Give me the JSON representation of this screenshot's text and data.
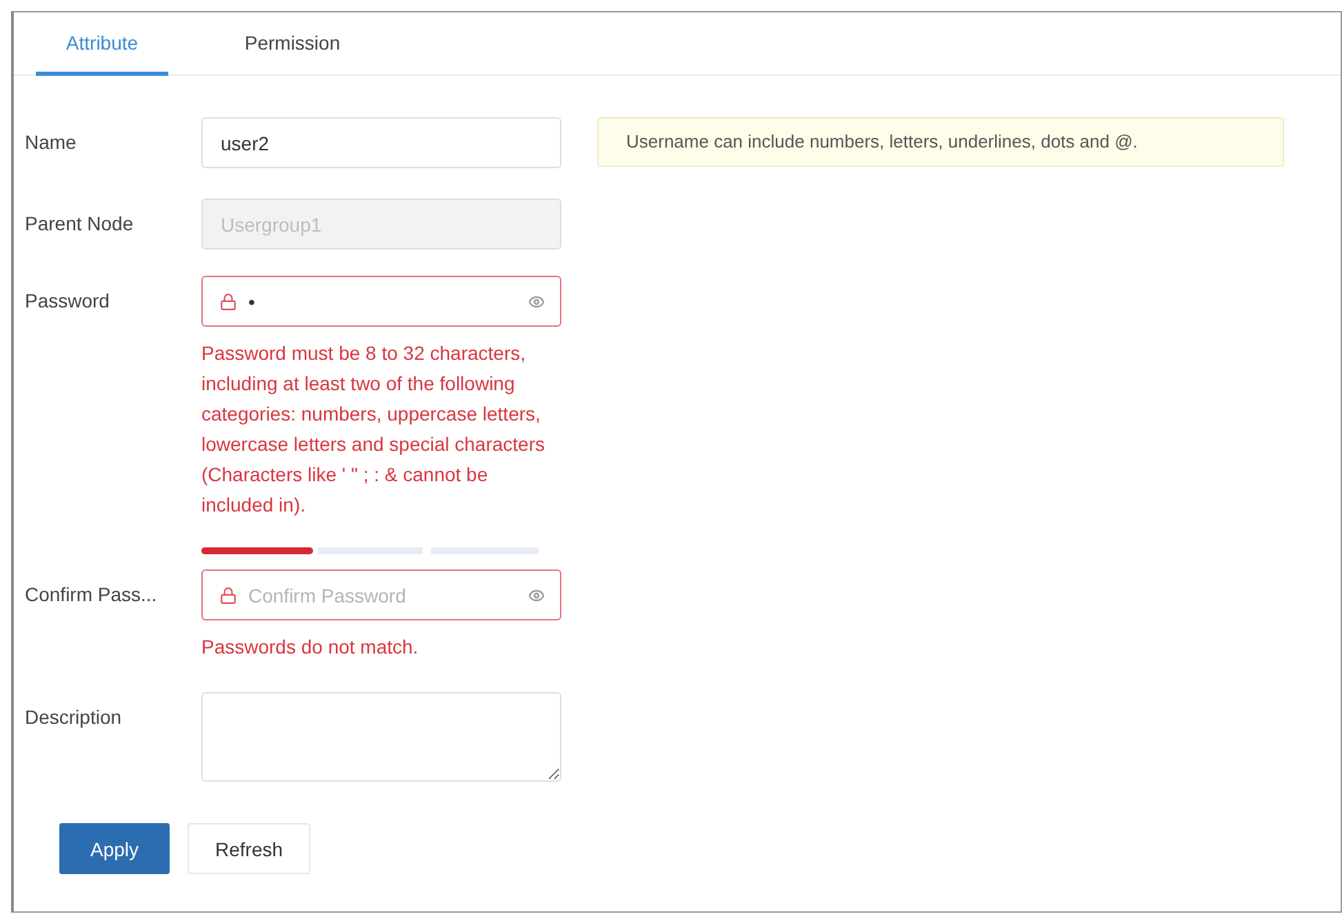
{
  "tabs": [
    {
      "label": "Attribute",
      "selected": true
    },
    {
      "label": "Permission",
      "selected": false
    }
  ],
  "form": {
    "fields": [
      {
        "kind": "text",
        "label": "Name",
        "value": "user2",
        "error": false,
        "disabled": false,
        "hint": "Username can include numbers, letters, underlines, dots and @."
      },
      {
        "kind": "text",
        "label": "Parent Node",
        "value": "Usergroup1",
        "error": false,
        "disabled": true
      },
      {
        "kind": "password",
        "label": "Password",
        "value": "•",
        "error": true,
        "disabled": false,
        "error_message": "Password must be 8 to 32 characters, including at least two of the following categories: numbers, uppercase letters, lowercase letters and special characters (Characters like ' \" ; : & cannot be included in).",
        "strength": {
          "level": 0.33
        }
      },
      {
        "kind": "password",
        "label": "Confirm Pass...",
        "placeholder": "Confirm Password",
        "error": true,
        "disabled": false,
        "error_message": "Passwords do not match."
      },
      {
        "kind": "textarea",
        "label": "Description",
        "error": false,
        "disabled": false
      }
    ]
  },
  "buttons": [
    {
      "label": "Apply",
      "kind": "primary"
    },
    {
      "label": "Refresh",
      "kind": "default"
    }
  ]
}
